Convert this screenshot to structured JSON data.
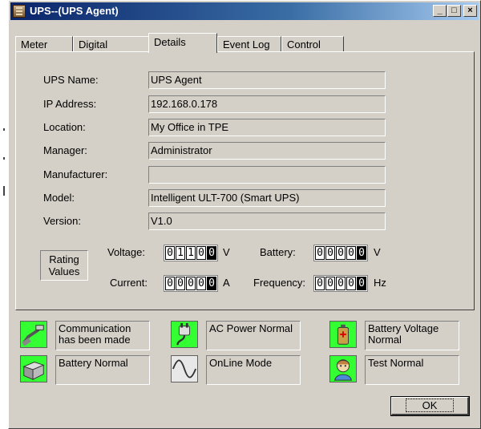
{
  "window": {
    "title": "UPS--(UPS Agent)",
    "buttons": {
      "minimize": "_",
      "maximize": "□",
      "close": "×"
    }
  },
  "tabs": [
    {
      "label": "Meter",
      "active": false
    },
    {
      "label": "Digital",
      "active": false
    },
    {
      "label": "Details",
      "active": true
    },
    {
      "label": "Event Log",
      "active": false
    },
    {
      "label": "Control",
      "active": false
    }
  ],
  "details": {
    "ups_name": {
      "label": "UPS Name:",
      "value": "UPS Agent"
    },
    "ip_address": {
      "label": "IP Address:",
      "value": "192.168.0.178"
    },
    "location": {
      "label": "Location:",
      "value": "My Office in TPE"
    },
    "manager": {
      "label": "Manager:",
      "value": "Administrator"
    },
    "manufacturer": {
      "label": "Manufacturer:",
      "value": ""
    },
    "model": {
      "label": "Model:",
      "value": "Intelligent ULT-700  (Smart UPS)"
    },
    "version": {
      "label": "Version:",
      "value": "V1.0"
    }
  },
  "rating": {
    "title_line1": "Rating",
    "title_line2": "Values",
    "voltage": {
      "label": "Voltage:",
      "digits": [
        "0",
        "1",
        "1",
        "0",
        "0"
      ],
      "unit": "V"
    },
    "current": {
      "label": "Current:",
      "digits": [
        "0",
        "0",
        "0",
        "0",
        "0"
      ],
      "unit": "A"
    },
    "battery": {
      "label": "Battery:",
      "digits": [
        "0",
        "0",
        "0",
        "0",
        "0"
      ],
      "unit": "V"
    },
    "frequency": {
      "label": "Frequency:",
      "digits": [
        "0",
        "0",
        "0",
        "0",
        "0"
      ],
      "unit": "Hz"
    }
  },
  "status": {
    "communication": {
      "line1": "Communication",
      "line2": "has been made",
      "icon": "network-cable-icon"
    },
    "ac_power": {
      "line1": "AC Power Normal",
      "line2": "",
      "icon": "power-plug-icon"
    },
    "battery_voltage": {
      "line1": "Battery Voltage",
      "line2": "Normal",
      "icon": "battery-icon"
    },
    "battery": {
      "line1": "Battery Normal",
      "line2": "",
      "icon": "ups-box-icon"
    },
    "online": {
      "line1": "OnLine Mode",
      "line2": "",
      "icon": "sine-wave-icon"
    },
    "test": {
      "line1": "Test Normal",
      "line2": "",
      "icon": "test-person-icon"
    }
  },
  "ok_label": "OK",
  "colors": {
    "status_green": "#33ff33",
    "title_blue": "#0a246a",
    "face": "#d4d0c8"
  }
}
